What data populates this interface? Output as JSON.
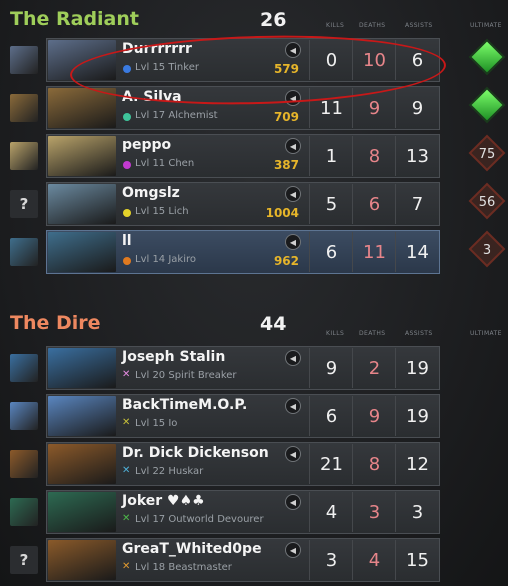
{
  "radiant": {
    "name": "The Radiant",
    "score": "26",
    "headers": {
      "kills": "KILLS",
      "deaths": "DEATHS",
      "assists": "ASSISTS",
      "ultimate": "ULTIMATE"
    },
    "players": [
      {
        "name": "Durrrrrrr",
        "level": "Lvl 15 Tinker",
        "gold": "579",
        "kills": "0",
        "deaths": "10",
        "assists": "6",
        "dot": "#3a7ae0",
        "ult": "",
        "ult_state": "ready",
        "hero_color": "#5d6e8a"
      },
      {
        "name": "A. Silva",
        "level": "Lvl 17 Alchemist",
        "gold": "709",
        "kills": "11",
        "deaths": "9",
        "assists": "9",
        "dot": "#3ec49a",
        "ult": "",
        "ult_state": "ready",
        "hero_color": "#8a6a3a"
      },
      {
        "name": "peppo",
        "level": "Lvl 11 Chen",
        "gold": "387",
        "kills": "1",
        "deaths": "8",
        "assists": "13",
        "dot": "#c23ad0",
        "ult": "75",
        "ult_state": "cd",
        "hero_color": "#b9a36a"
      },
      {
        "name": "Omgslz",
        "level": "Lvl 15 Lich",
        "gold": "1004",
        "kills": "5",
        "deaths": "6",
        "assists": "7",
        "dot": "#e4d22a",
        "ult": "56",
        "ult_state": "cd",
        "hero_color": "#6b8aa0"
      },
      {
        "name": "ll",
        "level": "Lvl 14 Jakiro",
        "gold": "962",
        "kills": "6",
        "deaths": "11",
        "assists": "14",
        "dot": "#e07a20",
        "ult": "3",
        "ult_state": "cd",
        "hero_color": "#3f6e8c"
      }
    ]
  },
  "dire": {
    "name": "The Dire",
    "score": "44",
    "headers": {
      "kills": "KILLS",
      "deaths": "DEATHS",
      "assists": "ASSISTS",
      "ultimate": "ULTIMATE"
    },
    "players": [
      {
        "name": "Joseph Stalin",
        "level": "Lvl 20 Spirit Breaker",
        "kills": "9",
        "deaths": "2",
        "assists": "19",
        "mark": "#e38be0",
        "hero_color": "#3a6fa0"
      },
      {
        "name": "BackTimeM.O.P.",
        "level": "Lvl 15 Io",
        "kills": "6",
        "deaths": "9",
        "assists": "19",
        "mark": "#c7c03a",
        "hero_color": "#5a86c0"
      },
      {
        "name": "Dr. Dick Dickenson",
        "level": "Lvl 22 Huskar",
        "kills": "21",
        "deaths": "8",
        "assists": "12",
        "mark": "#4fb0d8",
        "hero_color": "#8c5a2a"
      },
      {
        "name": "Joker ♥♠♣",
        "level": "Lvl 17 Outworld Devourer",
        "kills": "4",
        "deaths": "3",
        "assists": "3",
        "mark": "#4eb84a",
        "hero_color": "#2d6a52"
      },
      {
        "name": "GreaT_Whited0pe",
        "level": "Lvl 18 Beastmaster",
        "kills": "3",
        "deaths": "4",
        "assists": "15",
        "mark": "#e09a30",
        "hero_color": "#8a5a2a"
      }
    ]
  },
  "icons": {
    "speaker": "speaker-icon",
    "unknown": "?"
  }
}
